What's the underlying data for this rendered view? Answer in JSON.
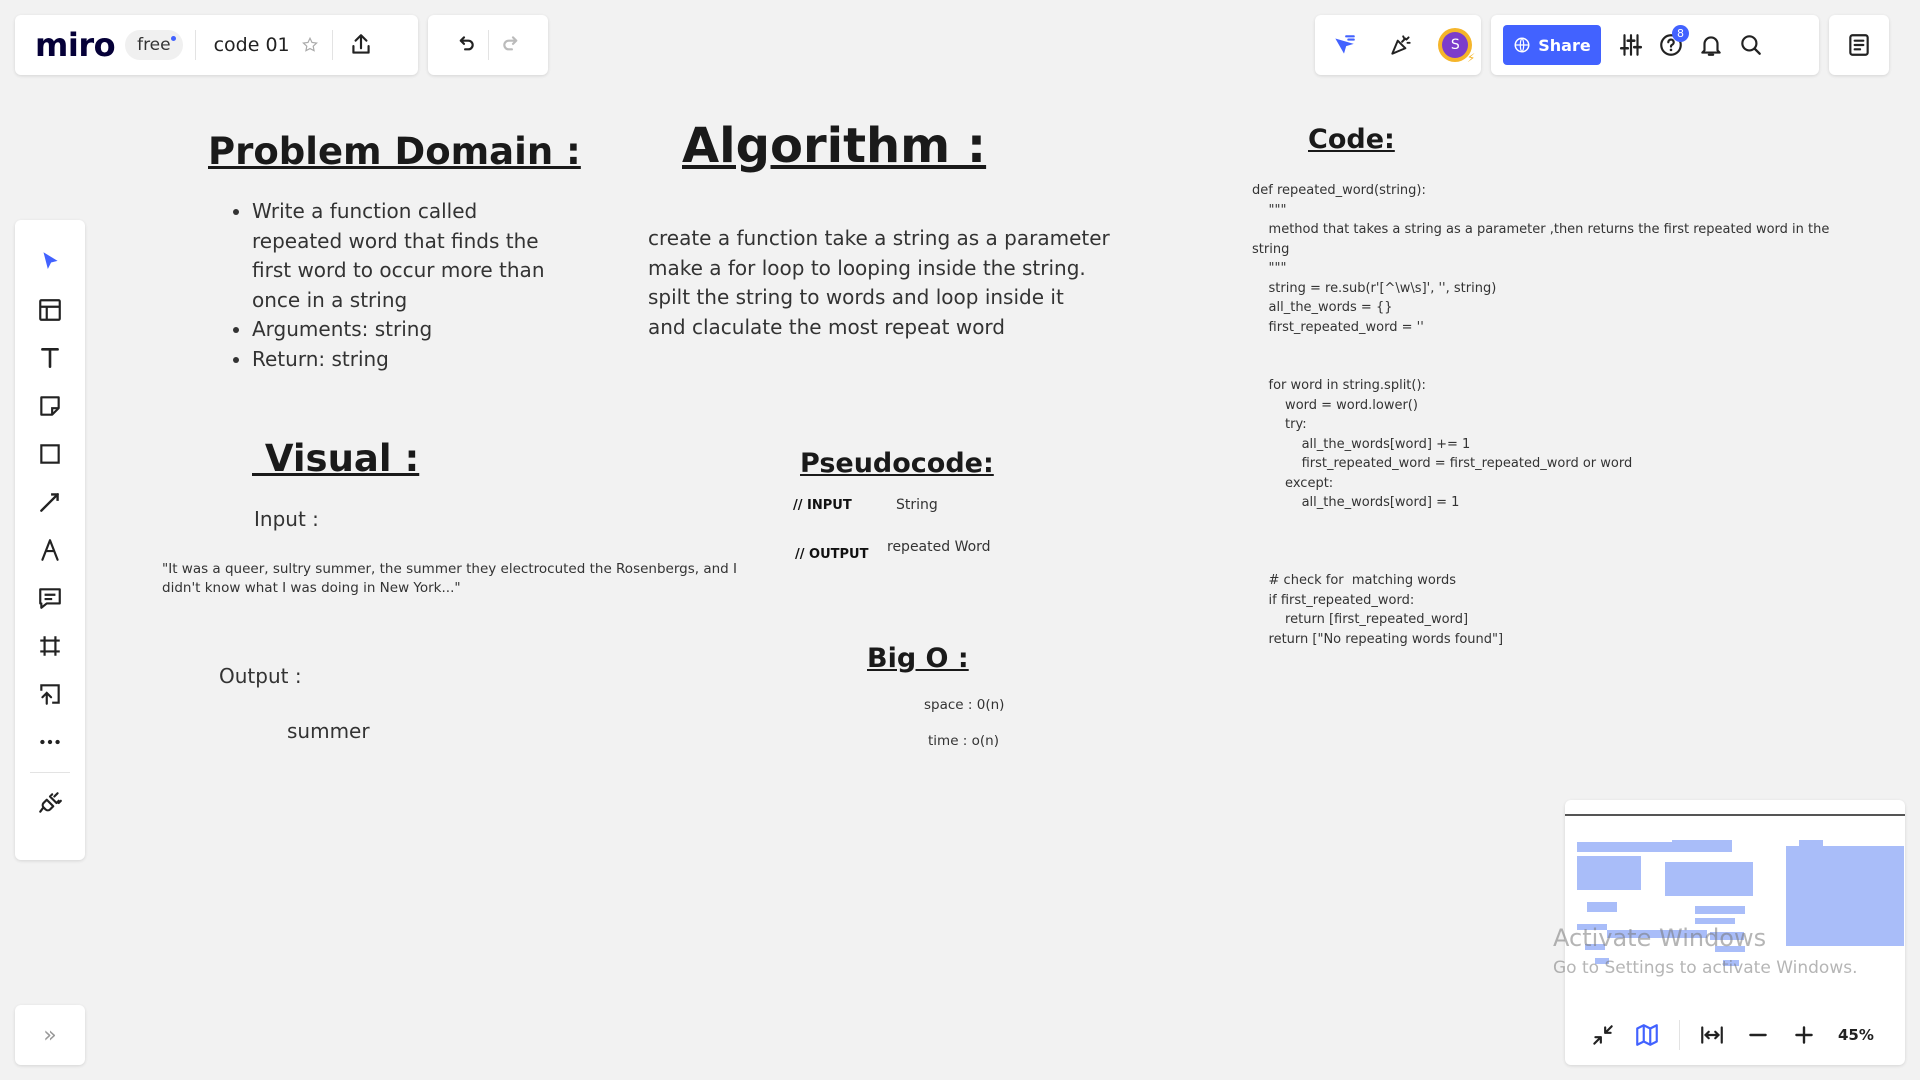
{
  "app": {
    "logo": "miro",
    "plan": "free",
    "board_title": "code 01"
  },
  "header": {
    "share_label": "Share",
    "help_badge": "8",
    "avatar_letter": "S"
  },
  "canvas": {
    "problem_domain": {
      "title": "Problem Domain :",
      "bullets": [
        "Write a function called repeated word that finds the first word to occur more than once in a string",
        "Arguments: string",
        "Return: string"
      ]
    },
    "algorithm": {
      "title": "Algorithm :",
      "lines": [
        "create a function take a string as a parameter",
        "make a for loop to looping inside the string.",
        "spilt the string to words and loop inside it",
        "and claculate the most repeat word"
      ]
    },
    "visual": {
      "title": " Visual :",
      "input_label": "Input :",
      "input_text": "\"It was a queer, sultry summer, the summer they electrocuted the Rosenbergs, and I didn't know what I was doing in New York...\"",
      "output_label": "Output :",
      "output_text": "summer"
    },
    "pseudocode": {
      "title": "Pseudocode:",
      "input_key": "// INPUT",
      "input_value": "String",
      "output_key": "// OUTPUT",
      "output_value": "repeated Word"
    },
    "bigo": {
      "title": "Big O :",
      "space": "space : 0(n)",
      "time": "time : o(n)"
    },
    "code": {
      "title": "Code:",
      "lines": [
        "def repeated_word(string):",
        "    \"\"\"",
        "    method that takes a string as a parameter ,then returns the first repeated word in the",
        "string",
        "    \"\"\"",
        "    string = re.sub(r'[^\\w\\s]', '', string)",
        "    all_the_words = {}",
        "    first_repeated_word = ''",
        "",
        "",
        "    for word in string.split():",
        "        word = word.lower()",
        "        try:",
        "            all_the_words[word] += 1",
        "            first_repeated_word = first_repeated_word or word",
        "        except:",
        "            all_the_words[word] = 1",
        "",
        "",
        "",
        "    # check for  matching words",
        "    if first_repeated_word:",
        "        return [first_repeated_word]",
        "    return [\"No repeating words found\"]"
      ]
    }
  },
  "watermark": {
    "title": "Activate Windows",
    "subtitle": "Go to Settings to activate Windows."
  },
  "zoom": {
    "level": "45%"
  }
}
